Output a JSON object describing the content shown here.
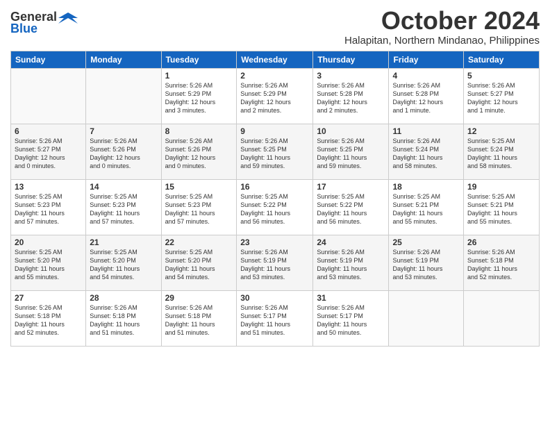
{
  "logo": {
    "general": "General",
    "blue": "Blue"
  },
  "title": "October 2024",
  "location": "Halapitan, Northern Mindanao, Philippines",
  "headers": [
    "Sunday",
    "Monday",
    "Tuesday",
    "Wednesday",
    "Thursday",
    "Friday",
    "Saturday"
  ],
  "weeks": [
    [
      {
        "day": "",
        "detail": ""
      },
      {
        "day": "",
        "detail": ""
      },
      {
        "day": "1",
        "detail": "Sunrise: 5:26 AM\nSunset: 5:29 PM\nDaylight: 12 hours\nand 3 minutes."
      },
      {
        "day": "2",
        "detail": "Sunrise: 5:26 AM\nSunset: 5:29 PM\nDaylight: 12 hours\nand 2 minutes."
      },
      {
        "day": "3",
        "detail": "Sunrise: 5:26 AM\nSunset: 5:28 PM\nDaylight: 12 hours\nand 2 minutes."
      },
      {
        "day": "4",
        "detail": "Sunrise: 5:26 AM\nSunset: 5:28 PM\nDaylight: 12 hours\nand 1 minute."
      },
      {
        "day": "5",
        "detail": "Sunrise: 5:26 AM\nSunset: 5:27 PM\nDaylight: 12 hours\nand 1 minute."
      }
    ],
    [
      {
        "day": "6",
        "detail": "Sunrise: 5:26 AM\nSunset: 5:27 PM\nDaylight: 12 hours\nand 0 minutes."
      },
      {
        "day": "7",
        "detail": "Sunrise: 5:26 AM\nSunset: 5:26 PM\nDaylight: 12 hours\nand 0 minutes."
      },
      {
        "day": "8",
        "detail": "Sunrise: 5:26 AM\nSunset: 5:26 PM\nDaylight: 12 hours\nand 0 minutes."
      },
      {
        "day": "9",
        "detail": "Sunrise: 5:26 AM\nSunset: 5:25 PM\nDaylight: 11 hours\nand 59 minutes."
      },
      {
        "day": "10",
        "detail": "Sunrise: 5:26 AM\nSunset: 5:25 PM\nDaylight: 11 hours\nand 59 minutes."
      },
      {
        "day": "11",
        "detail": "Sunrise: 5:26 AM\nSunset: 5:24 PM\nDaylight: 11 hours\nand 58 minutes."
      },
      {
        "day": "12",
        "detail": "Sunrise: 5:25 AM\nSunset: 5:24 PM\nDaylight: 11 hours\nand 58 minutes."
      }
    ],
    [
      {
        "day": "13",
        "detail": "Sunrise: 5:25 AM\nSunset: 5:23 PM\nDaylight: 11 hours\nand 57 minutes."
      },
      {
        "day": "14",
        "detail": "Sunrise: 5:25 AM\nSunset: 5:23 PM\nDaylight: 11 hours\nand 57 minutes."
      },
      {
        "day": "15",
        "detail": "Sunrise: 5:25 AM\nSunset: 5:23 PM\nDaylight: 11 hours\nand 57 minutes."
      },
      {
        "day": "16",
        "detail": "Sunrise: 5:25 AM\nSunset: 5:22 PM\nDaylight: 11 hours\nand 56 minutes."
      },
      {
        "day": "17",
        "detail": "Sunrise: 5:25 AM\nSunset: 5:22 PM\nDaylight: 11 hours\nand 56 minutes."
      },
      {
        "day": "18",
        "detail": "Sunrise: 5:25 AM\nSunset: 5:21 PM\nDaylight: 11 hours\nand 55 minutes."
      },
      {
        "day": "19",
        "detail": "Sunrise: 5:25 AM\nSunset: 5:21 PM\nDaylight: 11 hours\nand 55 minutes."
      }
    ],
    [
      {
        "day": "20",
        "detail": "Sunrise: 5:25 AM\nSunset: 5:20 PM\nDaylight: 11 hours\nand 55 minutes."
      },
      {
        "day": "21",
        "detail": "Sunrise: 5:25 AM\nSunset: 5:20 PM\nDaylight: 11 hours\nand 54 minutes."
      },
      {
        "day": "22",
        "detail": "Sunrise: 5:25 AM\nSunset: 5:20 PM\nDaylight: 11 hours\nand 54 minutes."
      },
      {
        "day": "23",
        "detail": "Sunrise: 5:26 AM\nSunset: 5:19 PM\nDaylight: 11 hours\nand 53 minutes."
      },
      {
        "day": "24",
        "detail": "Sunrise: 5:26 AM\nSunset: 5:19 PM\nDaylight: 11 hours\nand 53 minutes."
      },
      {
        "day": "25",
        "detail": "Sunrise: 5:26 AM\nSunset: 5:19 PM\nDaylight: 11 hours\nand 53 minutes."
      },
      {
        "day": "26",
        "detail": "Sunrise: 5:26 AM\nSunset: 5:18 PM\nDaylight: 11 hours\nand 52 minutes."
      }
    ],
    [
      {
        "day": "27",
        "detail": "Sunrise: 5:26 AM\nSunset: 5:18 PM\nDaylight: 11 hours\nand 52 minutes."
      },
      {
        "day": "28",
        "detail": "Sunrise: 5:26 AM\nSunset: 5:18 PM\nDaylight: 11 hours\nand 51 minutes."
      },
      {
        "day": "29",
        "detail": "Sunrise: 5:26 AM\nSunset: 5:18 PM\nDaylight: 11 hours\nand 51 minutes."
      },
      {
        "day": "30",
        "detail": "Sunrise: 5:26 AM\nSunset: 5:17 PM\nDaylight: 11 hours\nand 51 minutes."
      },
      {
        "day": "31",
        "detail": "Sunrise: 5:26 AM\nSunset: 5:17 PM\nDaylight: 11 hours\nand 50 minutes."
      },
      {
        "day": "",
        "detail": ""
      },
      {
        "day": "",
        "detail": ""
      }
    ]
  ]
}
